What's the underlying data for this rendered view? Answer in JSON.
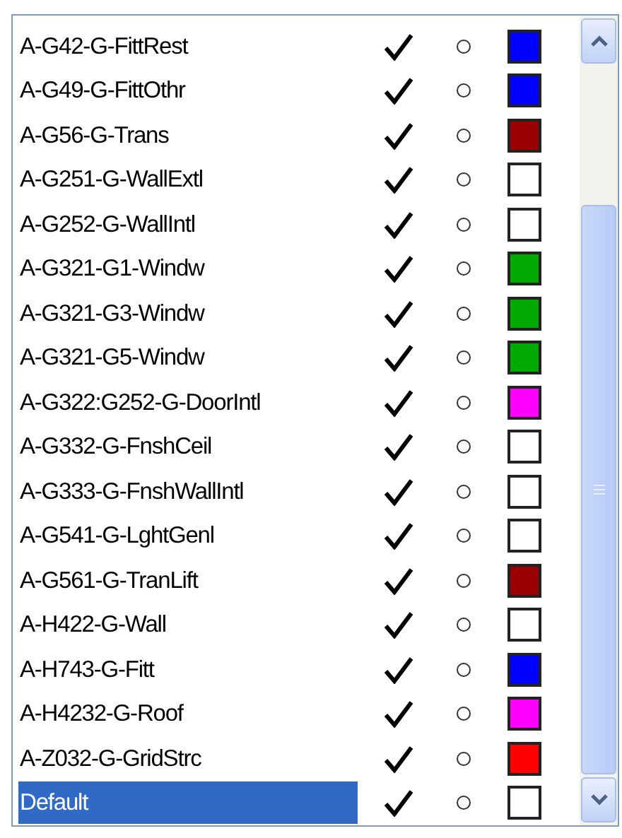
{
  "layers": [
    {
      "name": "A-G42-G-FittRest",
      "selected": false,
      "visible": true,
      "filled": false,
      "color": "#0000ff"
    },
    {
      "name": "A-G49-G-FittOthr",
      "selected": false,
      "visible": true,
      "filled": false,
      "color": "#0000ff"
    },
    {
      "name": "A-G56-G-Trans",
      "selected": false,
      "visible": true,
      "filled": false,
      "color": "#990000"
    },
    {
      "name": "A-G251-G-WallExtl",
      "selected": false,
      "visible": true,
      "filled": false,
      "color": "#ffffff"
    },
    {
      "name": "A-G252-G-WallIntl",
      "selected": false,
      "visible": true,
      "filled": false,
      "color": "#ffffff"
    },
    {
      "name": "A-G321-G1-Windw",
      "selected": false,
      "visible": true,
      "filled": false,
      "color": "#00aa00"
    },
    {
      "name": "A-G321-G3-Windw",
      "selected": false,
      "visible": true,
      "filled": false,
      "color": "#00aa00"
    },
    {
      "name": "A-G321-G5-Windw",
      "selected": false,
      "visible": true,
      "filled": false,
      "color": "#00aa00"
    },
    {
      "name": "A-G322:G252-G-DoorIntl",
      "selected": false,
      "visible": true,
      "filled": false,
      "color": "#ff00ff"
    },
    {
      "name": "A-G332-G-FnshCeil",
      "selected": false,
      "visible": true,
      "filled": false,
      "color": "#ffffff"
    },
    {
      "name": "A-G333-G-FnshWallIntl",
      "selected": false,
      "visible": true,
      "filled": false,
      "color": "#ffffff"
    },
    {
      "name": "A-G541-G-LghtGenl",
      "selected": false,
      "visible": true,
      "filled": false,
      "color": "#ffffff"
    },
    {
      "name": "A-G561-G-TranLift",
      "selected": false,
      "visible": true,
      "filled": false,
      "color": "#990000"
    },
    {
      "name": "A-H422-G-Wall",
      "selected": false,
      "visible": true,
      "filled": false,
      "color": "#ffffff"
    },
    {
      "name": "A-H743-G-Fitt",
      "selected": false,
      "visible": true,
      "filled": false,
      "color": "#0000ff"
    },
    {
      "name": "A-H4232-G-Roof",
      "selected": false,
      "visible": true,
      "filled": false,
      "color": "#ff00ff"
    },
    {
      "name": "A-Z032-G-GridStrc",
      "selected": false,
      "visible": true,
      "filled": false,
      "color": "#ff0000"
    },
    {
      "name": "Default",
      "selected": true,
      "visible": true,
      "filled": false,
      "color": "#ffffff"
    }
  ]
}
